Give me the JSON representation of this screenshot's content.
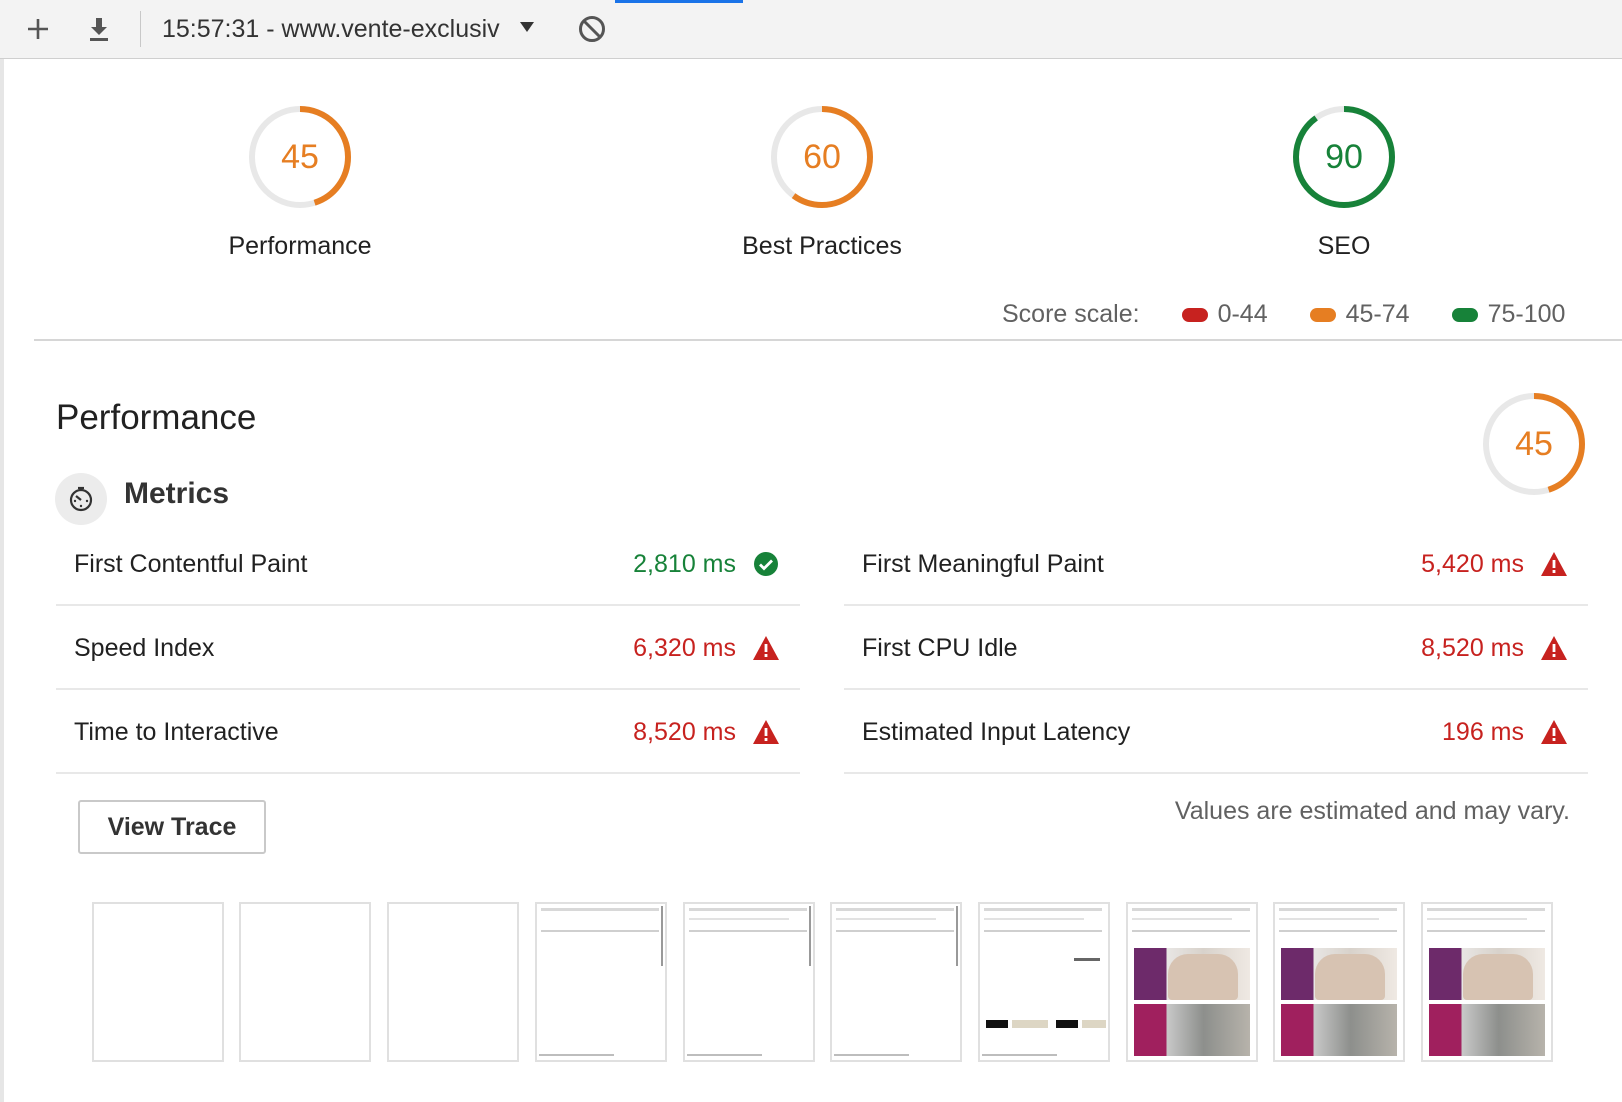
{
  "toolbar": {
    "timestamp_url": "15:57:31 - www.vente-exclusiv",
    "icons": [
      "plus-icon",
      "download-icon",
      "dropdown-arrow-icon",
      "clear-icon"
    ]
  },
  "categories": [
    {
      "label": "Performance",
      "score": "45",
      "score_value": 45,
      "color": "#e67e22"
    },
    {
      "label": "Best Practices",
      "score": "60",
      "score_value": 60,
      "color": "#e67e22"
    },
    {
      "label": "SEO",
      "score": "90",
      "score_value": 90,
      "color": "#178239"
    }
  ],
  "score_scale": {
    "label": "Score scale:",
    "ranges": [
      {
        "label": "0-44",
        "color": "#c7221f"
      },
      {
        "label": "45-74",
        "color": "#e67e22"
      },
      {
        "label": "75-100",
        "color": "#178239"
      }
    ]
  },
  "performance": {
    "title": "Performance",
    "score": "45",
    "score_value": 45,
    "metrics_title": "Metrics",
    "metrics": [
      {
        "name": "First Contentful Paint",
        "value": "2,810 ms",
        "status": "pass"
      },
      {
        "name": "First Meaningful Paint",
        "value": "5,420 ms",
        "status": "fail"
      },
      {
        "name": "Speed Index",
        "value": "6,320 ms",
        "status": "fail"
      },
      {
        "name": "First CPU Idle",
        "value": "8,520 ms",
        "status": "fail"
      },
      {
        "name": "Time to Interactive",
        "value": "8,520 ms",
        "status": "fail"
      },
      {
        "name": "Estimated Input Latency",
        "value": "196 ms",
        "status": "fail"
      }
    ],
    "view_trace_label": "View Trace",
    "disclaimer": "Values are estimated and may vary."
  },
  "colors": {
    "pass": "#178239",
    "average": "#e67e22",
    "fail": "#c7221f"
  }
}
